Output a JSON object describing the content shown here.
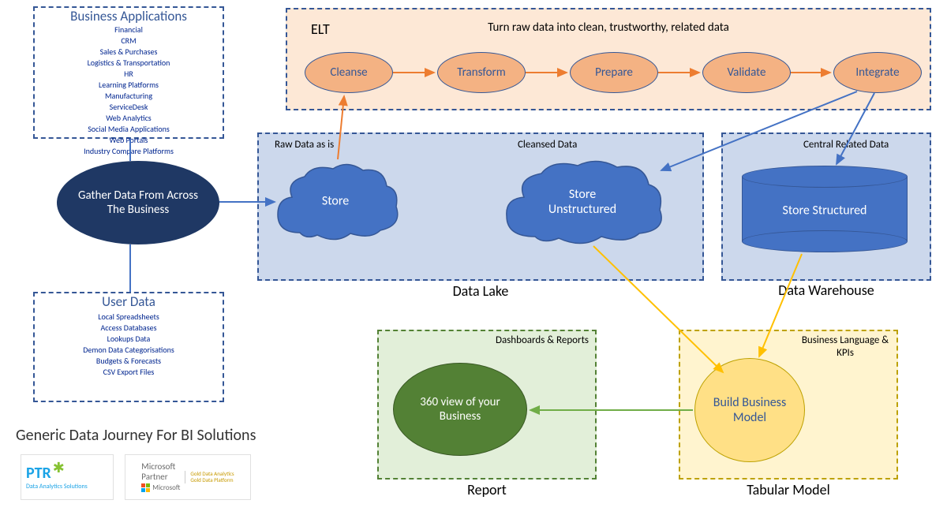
{
  "diagram_title": "Generic Data Journey For BI Solutions",
  "business_apps": {
    "title": "Business Applications",
    "items": [
      "Financial",
      "CRM",
      "Sales & Purchases",
      "Logistics & Transportation",
      "HR",
      "Learning Platforms",
      "Manufacturing",
      "ServiceDesk",
      "Web Analytics",
      "Social Media Applications",
      "Web Portals",
      "Industry Compare Platforms"
    ]
  },
  "user_data": {
    "title": "User Data",
    "items": [
      "Local Spreadsheets",
      "Access Databases",
      "Lookups Data",
      "Demon Data Categorisations",
      "Budgets & Forecasts",
      "CSV Export Files"
    ]
  },
  "gather": "Gather Data From Across The Business",
  "elt": {
    "title": "ELT",
    "subtitle": "Turn raw data into clean, trustworthy, related data",
    "steps": [
      "Cleanse",
      "Transform",
      "Prepare",
      "Validate",
      "Integrate"
    ]
  },
  "data_lake": {
    "title": "Data Lake",
    "raw_label": "Raw Data as is",
    "raw_cloud": "Store",
    "clean_label": "Cleansed Data",
    "clean_cloud": "Store Unstructured"
  },
  "warehouse": {
    "title": "Data Warehouse",
    "label": "Central Related Data",
    "cylinder": "Store Structured"
  },
  "tabular": {
    "title": "Tabular Model",
    "label": "Business Language & KPIs",
    "ellipse": "Build Business Model"
  },
  "report": {
    "title": "Report",
    "label": "Dashboards & Reports",
    "ellipse": "360 view of your Business"
  },
  "logos": {
    "ptr_brand": "PTR",
    "ptr_sub": "Data Analytics Solutions",
    "ms_line1": "Microsoft",
    "ms_line2": "Partner",
    "ms_line3": "Microsoft",
    "gold1": "Gold Data Analytics",
    "gold2": "Gold Data Platform"
  }
}
